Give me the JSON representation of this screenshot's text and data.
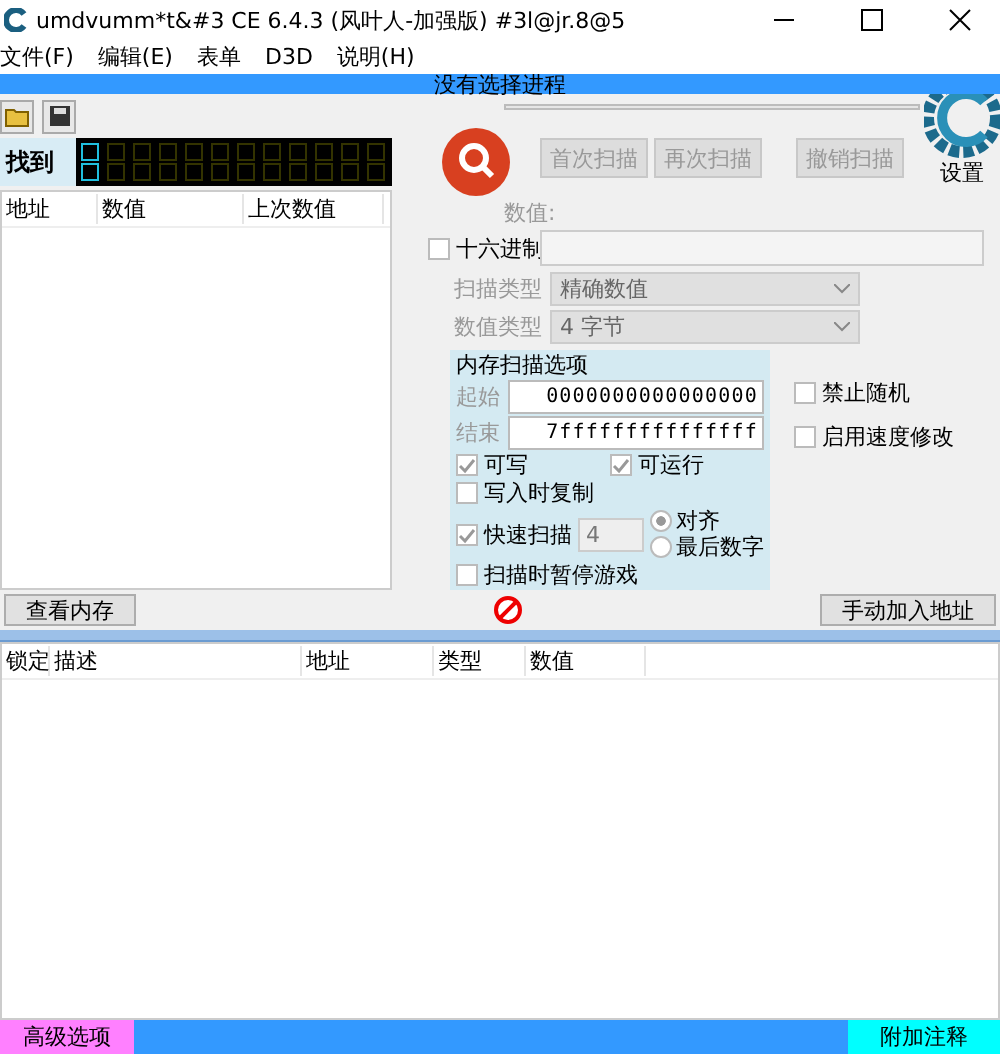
{
  "window": {
    "title": "umdvumm*t&#3  CE 6.4.3 (风叶人-加强版)  #3l@jr.8@5"
  },
  "menu": [
    "文件(F)",
    "编辑(E)",
    "表单",
    "D3D",
    "说明(H)"
  ],
  "process_label": "没有选择进程",
  "found_label": "找到",
  "found_columns": [
    "地址",
    "数值",
    "上次数值"
  ],
  "scan_buttons": [
    {
      "label": "首次扫描",
      "disabled": true
    },
    {
      "label": "再次扫描",
      "disabled": true
    },
    {
      "label": "撤销扫描",
      "disabled": true
    }
  ],
  "settings_label": "设置",
  "value_label": "数值:",
  "hex": {
    "label": "十六进制",
    "checked": false
  },
  "scan_type": {
    "label": "扫描类型",
    "value": "精确数值"
  },
  "value_type": {
    "label": "数值类型",
    "value": "4 字节"
  },
  "memory_options": {
    "title": "内存扫描选项",
    "start_label": "起始",
    "start": "0000000000000000",
    "end_label": "结束",
    "end": "7fffffffffffffff",
    "writable": {
      "label": "可写",
      "checked": true
    },
    "executable": {
      "label": "可运行",
      "checked": true
    },
    "copy_on_write": {
      "label": "写入时复制",
      "checked": false
    },
    "fast_scan": {
      "label": "快速扫描",
      "checked": true,
      "value": "4"
    },
    "alignment": [
      {
        "label": "对齐",
        "selected": true
      },
      {
        "label": "最后数字",
        "selected": false
      }
    ],
    "pause_game": {
      "label": "扫描时暂停游戏",
      "checked": false
    }
  },
  "side_options": [
    {
      "label": "禁止随机",
      "checked": false
    },
    {
      "label": "启用速度修改",
      "checked": false
    }
  ],
  "view_memory": "查看内存",
  "add_address": "手动加入地址",
  "table_columns": [
    "锁定",
    "描述",
    "地址",
    "类型",
    "数值"
  ],
  "status_bar": {
    "left": "高级选项",
    "right": "附加注释"
  }
}
